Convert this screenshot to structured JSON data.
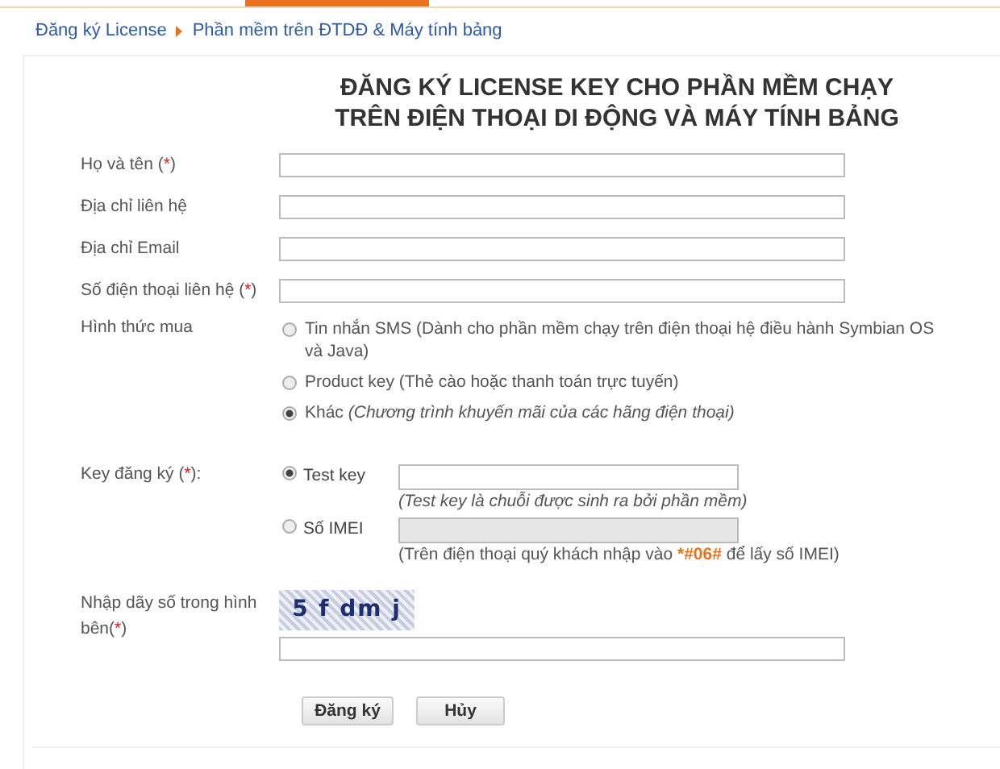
{
  "breadcrumb": [
    {
      "label": "Đăng ký License"
    },
    {
      "label": "Phần mềm trên ĐTDĐ & Máy tính bảng"
    }
  ],
  "title_lines": [
    "ĐĂNG KÝ LICENSE KEY CHO PHẦN MỀM CHẠY",
    "TRÊN ĐIỆN THOẠI DI ĐỘNG VÀ MÁY TÍNH BẢNG"
  ],
  "text_fields": [
    {
      "label": "Họ và tên (",
      "required_mark": "*",
      "label_end": ")"
    },
    {
      "label": "Địa chỉ liên hệ"
    },
    {
      "label": "Địa chỉ Email"
    },
    {
      "label": "Số điện thoại liên hệ (",
      "required_mark": "*",
      "label_end": ")"
    }
  ],
  "purchase": {
    "label": "Hình thức mua",
    "options": [
      {
        "text": "Tin nhắn SMS (Dành cho phần mềm chạy trên điện thoại hệ điều hành Symbian OS và Java)",
        "selected": false
      },
      {
        "text": "Product key (Thẻ cào hoặc thanh toán trực tuyến)",
        "selected": false
      },
      {
        "text": "Khác *(Chương trình khuyến mãi của các hãng điện thoại)*",
        "selected": true
      }
    ]
  },
  "key": {
    "label": "Key đăng ký (",
    "required_mark": "*",
    "label_end": "):",
    "options": [
      {
        "label": "Test key",
        "selected": true,
        "disabled": false,
        "hint": "(Test key là chuỗi được sinh ra bởi phần mềm)",
        "hint_italic": true
      },
      {
        "label": "Số IMEI",
        "selected": false,
        "disabled": true,
        "hint": "(Trên điện thoại quý khách nhập vào ",
        "hint_code": "*#06#",
        "hint_end": " để lấy số IMEI)",
        "hint_italic": false
      }
    ]
  },
  "captcha": {
    "label": "Nhập dãy số trong hình bên(",
    "required_mark": "*",
    "label_end": ")",
    "code": "5 f dm j"
  },
  "buttons": [
    {
      "label": "Đăng ký"
    },
    {
      "label": "Hủy"
    }
  ]
}
